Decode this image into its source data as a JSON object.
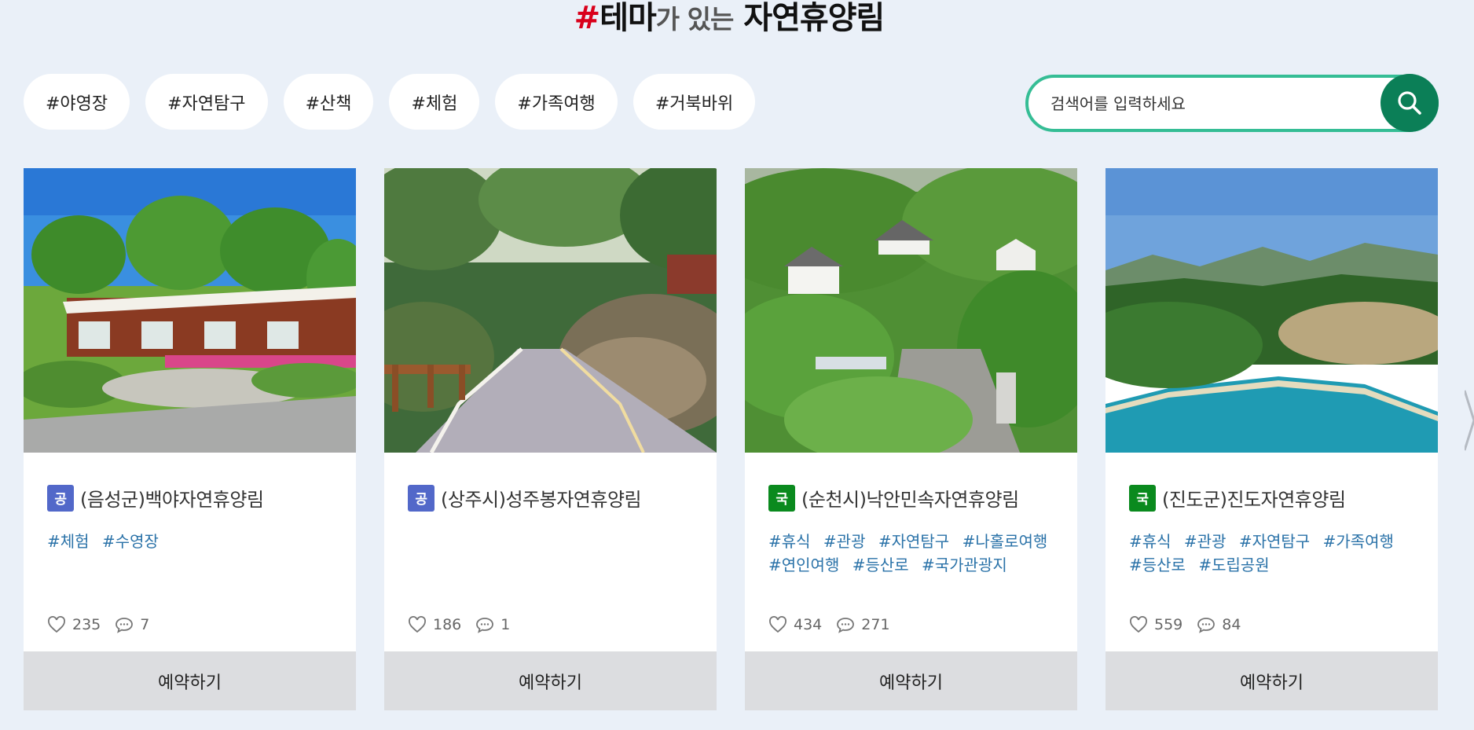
{
  "title": {
    "hash": "#",
    "theme": "테마",
    "connector": "가 있는",
    "subject": "자연휴양림"
  },
  "tags": [
    "#야영장",
    "#자연탐구",
    "#산책",
    "#체험",
    "#가족여행",
    "#거북바위"
  ],
  "search": {
    "placeholder": "검색어를 입력하세요",
    "icon": "search-icon"
  },
  "cards": [
    {
      "badge": "공",
      "badge_type": "pub",
      "name": "(음성군)백야자연휴양림",
      "tags": [
        "#체험",
        "#수영장"
      ],
      "likes": "235",
      "comments": "7",
      "button": "예약하기"
    },
    {
      "badge": "공",
      "badge_type": "pub",
      "name": "(상주시)성주봉자연휴양림",
      "tags": [],
      "likes": "186",
      "comments": "1",
      "button": "예약하기"
    },
    {
      "badge": "국",
      "badge_type": "nat",
      "name": "(순천시)낙안민속자연휴양림",
      "tags": [
        "#휴식",
        "#관광",
        "#자연탐구",
        "#나홀로여행",
        "#연인여행",
        "#등산로",
        "#국가관광지"
      ],
      "likes": "434",
      "comments": "271",
      "button": "예약하기"
    },
    {
      "badge": "국",
      "badge_type": "nat",
      "name": "(진도군)진도자연휴양림",
      "tags": [
        "#휴식",
        "#관광",
        "#자연탐구",
        "#가족여행",
        "#등산로",
        "#도립공원"
      ],
      "likes": "559",
      "comments": "84",
      "button": "예약하기"
    }
  ],
  "colors": {
    "accent_red": "#d9001b",
    "search_border": "#35bd95",
    "search_button": "#0b7f57",
    "tag_text": "#2a72a8",
    "badge_public": "#5268c9",
    "badge_national": "#0a8a1e"
  }
}
